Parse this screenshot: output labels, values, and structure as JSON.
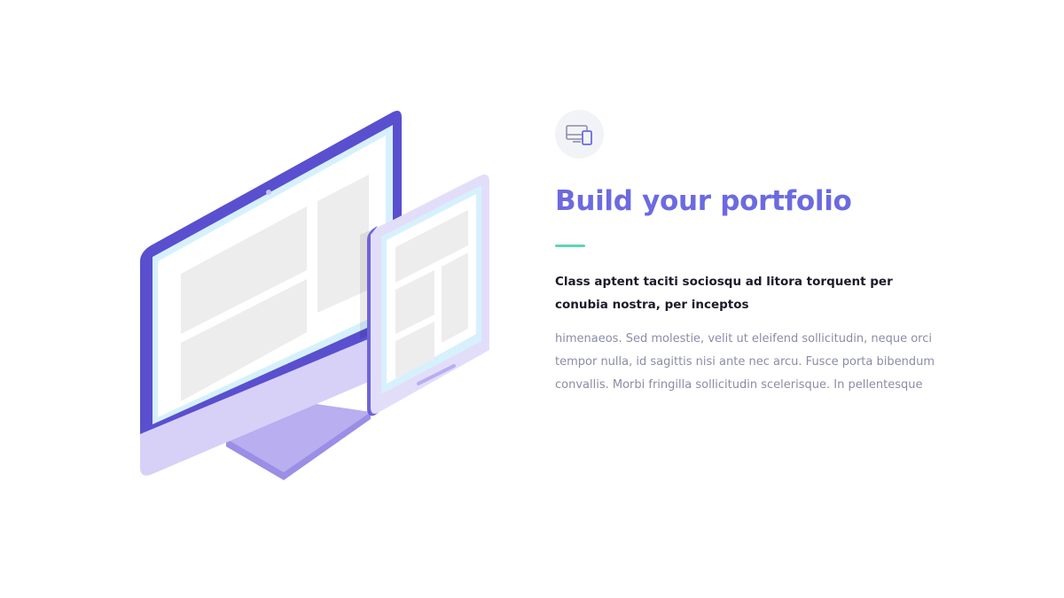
{
  "feature": {
    "icon": "devices-icon",
    "title": "Build your portfolio",
    "lead": "Class aptent taciti sociosqu ad litora torquent per conubia nostra, per inceptos",
    "body": "himenaeos. Sed molestie, velit ut eleifend sollicitudin, neque orci tempor nulla, id sagittis nisi ante nec arcu. Fusce porta bibendum convallis. Morbi fringilla sollicitudin scelerisque. In pellentesque"
  },
  "colors": {
    "accent": "#6c6ae0",
    "accent_bar": "#5fd5b6",
    "device_dark": "#5a4fcf",
    "device_light": "#d5d0f7",
    "screen_glow": "#d6f1fc",
    "screen_panel": "#ededed"
  }
}
